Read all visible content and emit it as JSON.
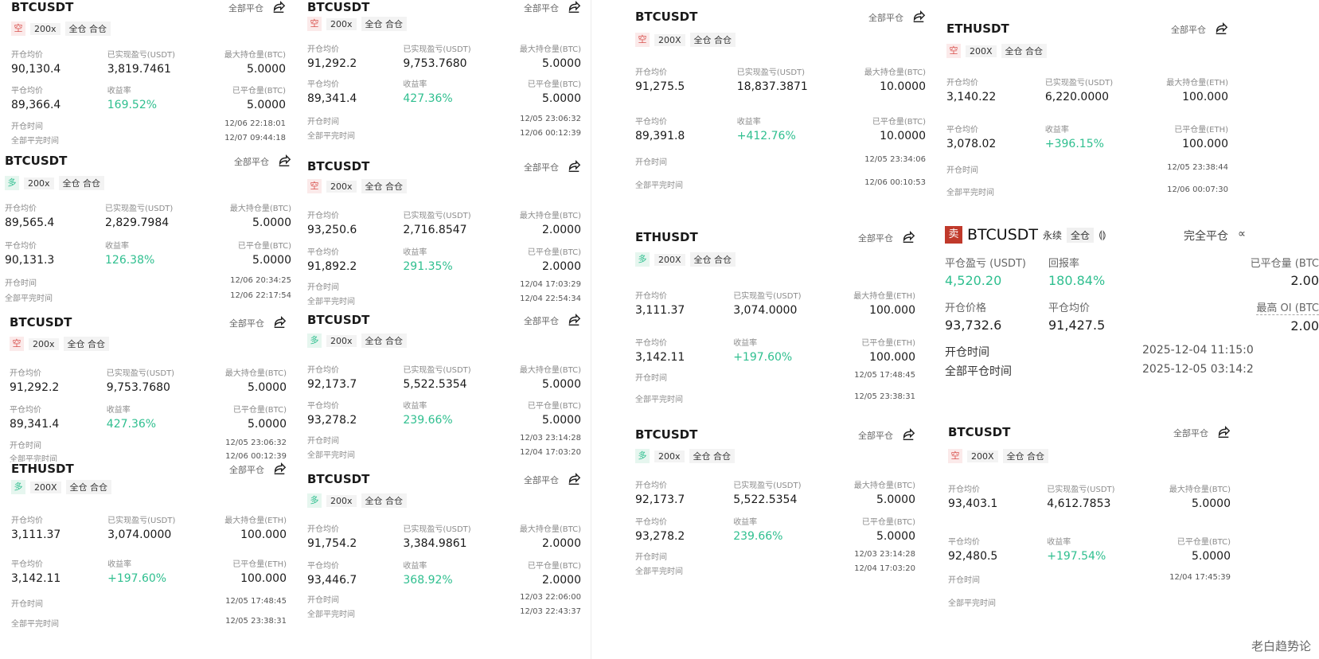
{
  "labels": {
    "close_all": "全部平仓",
    "open_avg": "开仓均价",
    "realized_pnl": "已实现盈亏(USDT)",
    "max_pos_btc": "最大持仓量(BTC)",
    "max_pos_eth": "最大持仓量(ETH)",
    "close_avg": "平仓均价",
    "yield": "收益率",
    "closed_btc": "已平仓量(BTC)",
    "closed_eth": "已平仓量(ETH)",
    "open_time": "开仓时间",
    "all_close_time": "全部平完时间",
    "cross_merge": "全仓 合仓",
    "short": "空",
    "long": "多"
  },
  "cards": [
    {
      "symbol": "BTCUSDT",
      "dir": "short",
      "lev": "200x",
      "open": "90,130.4",
      "pnl": "3,819.7461",
      "maxpos": "5.0000",
      "close": "89,366.4",
      "yield": "169.52%",
      "closed": "5.0000",
      "t1": "12/06 22:18:01",
      "t2": "12/07 09:44:18",
      "asset": "BTC"
    },
    {
      "symbol": "BTCUSDT",
      "dir": "long",
      "lev": "200x",
      "open": "89,565.4",
      "pnl": "2,829.7984",
      "maxpos": "5.0000",
      "close": "90,131.3",
      "yield": "126.38%",
      "closed": "5.0000",
      "t1": "12/06 20:34:25",
      "t2": "12/06 22:17:54",
      "asset": "BTC"
    },
    {
      "symbol": "BTCUSDT",
      "dir": "short",
      "lev": "200x",
      "open": "91,292.2",
      "pnl": "9,753.7680",
      "maxpos": "5.0000",
      "close": "89,341.4",
      "yield": "427.36%",
      "closed": "5.0000",
      "t1": "12/05 23:06:32",
      "t2": "12/06 00:12:39",
      "asset": "BTC"
    },
    {
      "symbol": "ETHUSDT",
      "dir": "long",
      "lev": "200X",
      "open": "3,111.37",
      "pnl": "3,074.0000",
      "maxpos": "100.000",
      "close": "3,142.11",
      "yield": "+197.60%",
      "closed": "100.000",
      "t1": "12/05 17:48:45",
      "t2": "12/05 23:38:31",
      "asset": "ETH"
    },
    {
      "symbol": "BTCUSDT",
      "dir": "short",
      "lev": "200x",
      "open": "91,292.2",
      "pnl": "9,753.7680",
      "maxpos": "5.0000",
      "close": "89,341.4",
      "yield": "427.36%",
      "closed": "5.0000",
      "t1": "12/05 23:06:32",
      "t2": "12/06 00:12:39",
      "asset": "BTC"
    },
    {
      "symbol": "BTCUSDT",
      "dir": "short",
      "lev": "200x",
      "open": "93,250.6",
      "pnl": "2,716.8547",
      "maxpos": "2.0000",
      "close": "91,892.2",
      "yield": "291.35%",
      "closed": "2.0000",
      "t1": "12/04 17:03:29",
      "t2": "12/04 22:54:34",
      "asset": "BTC"
    },
    {
      "symbol": "BTCUSDT",
      "dir": "long",
      "lev": "200x",
      "open": "92,173.7",
      "pnl": "5,522.5354",
      "maxpos": "5.0000",
      "close": "93,278.2",
      "yield": "239.66%",
      "closed": "5.0000",
      "t1": "12/03 23:14:28",
      "t2": "12/04 17:03:20",
      "asset": "BTC"
    },
    {
      "symbol": "BTCUSDT",
      "dir": "long",
      "lev": "200x",
      "open": "91,754.2",
      "pnl": "3,384.9861",
      "maxpos": "2.0000",
      "close": "93,446.7",
      "yield": "368.92%",
      "closed": "2.0000",
      "t1": "12/03 22:06:00",
      "t2": "12/03 22:43:37",
      "asset": "BTC"
    },
    {
      "symbol": "BTCUSDT",
      "dir": "short",
      "lev": "200X",
      "open": "91,275.5",
      "pnl": "18,837.3871",
      "maxpos": "10.0000",
      "close": "89,391.8",
      "yield": "+412.76%",
      "closed": "10.0000",
      "t1": "12/05 23:34:06",
      "t2": "12/06 00:10:53",
      "asset": "BTC"
    },
    {
      "symbol": "ETHUSDT",
      "dir": "long",
      "lev": "200X",
      "open": "3,111.37",
      "pnl": "3,074.0000",
      "maxpos": "100.000",
      "close": "3,142.11",
      "yield": "+197.60%",
      "closed": "100.000",
      "t1": "12/05 17:48:45",
      "t2": "12/05 23:38:31",
      "asset": "ETH"
    },
    {
      "symbol": "BTCUSDT",
      "dir": "long",
      "lev": "200x",
      "open": "92,173.7",
      "pnl": "5,522.5354",
      "maxpos": "5.0000",
      "close": "93,278.2",
      "yield": "239.66%",
      "closed": "5.0000",
      "t1": "12/03 23:14:28",
      "t2": "12/04 17:03:20",
      "asset": "BTC"
    },
    {
      "symbol": "ETHUSDT",
      "dir": "short",
      "lev": "200X",
      "open": "3,140.22",
      "pnl": "6,220.0000",
      "maxpos": "100.000",
      "close": "3,078.02",
      "yield": "+396.15%",
      "closed": "100.000",
      "t1": "12/05 23:38:44",
      "t2": "12/06 00:07:30",
      "asset": "ETH"
    },
    {
      "symbol": "BTCUSDT",
      "dir": "short",
      "lev": "200X",
      "open": "93,403.1",
      "pnl": "4,612.7853",
      "maxpos": "5.0000",
      "close": "92,480.5",
      "yield": "+197.54%",
      "closed": "5.0000",
      "t1": "12/04 17:45:39",
      "t2": "",
      "asset": "BTC"
    }
  ],
  "big": {
    "sell": "卖",
    "symbol": "BTCUSDT",
    "perp": "永续",
    "cross": "全仓",
    "close_all": "完全平仓",
    "pnl_lbl": "平仓盈亏 (USDT)",
    "pnl": "4,520.20",
    "roi_lbl": "回报率",
    "roi": "180.84%",
    "closed_lbl": "已平仓量 (BTC",
    "closed": "2.00",
    "open_price_lbl": "开仓价格",
    "open_price": "93,732.6",
    "close_avg_lbl": "平仓均价",
    "close_avg": "91,427.5",
    "max_oi_lbl": "最高 OI (BTC",
    "max_oi": "2.00",
    "open_time_lbl": "开仓时间",
    "open_time": "2025-12-04 11:15:0",
    "close_time_lbl": "全部平仓时间",
    "close_time": "2025-12-05 03:14:2"
  },
  "watermark": "老白趋势论"
}
